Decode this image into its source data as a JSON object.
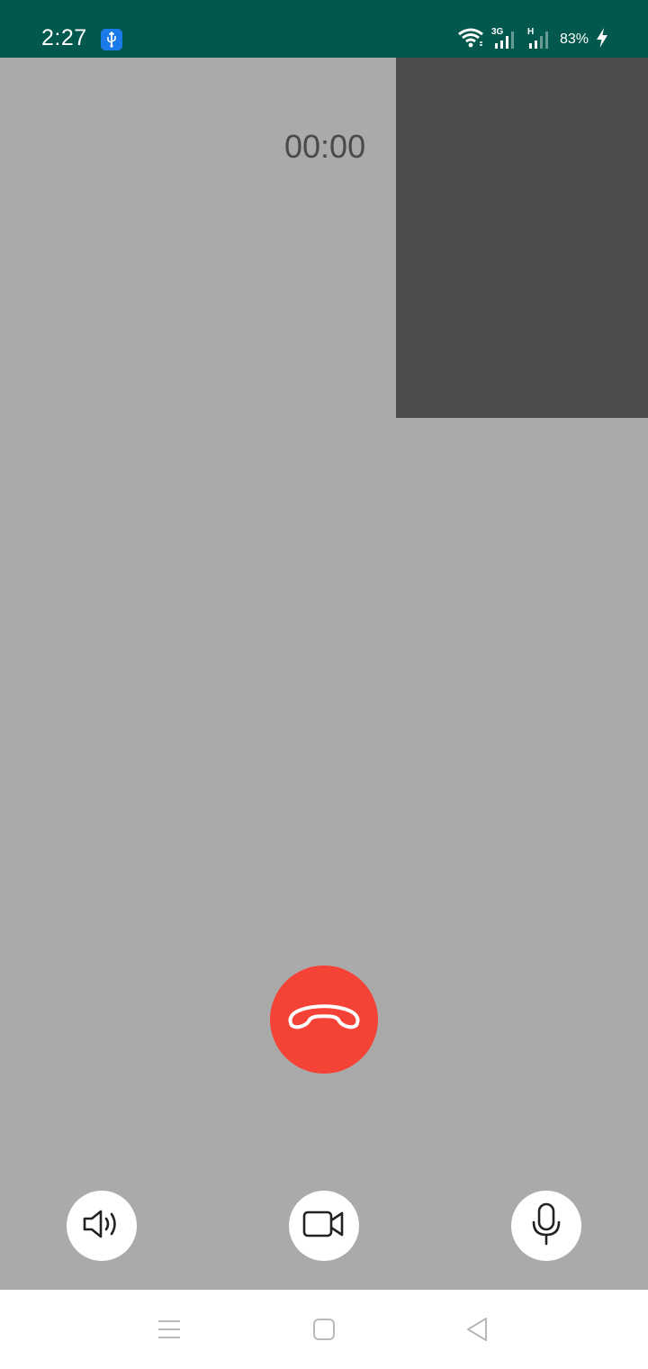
{
  "status_bar": {
    "time": "2:27",
    "network_1": "3G",
    "network_2": "H",
    "battery": "83%",
    "icons": [
      "usb-debug-icon",
      "wifi-icon",
      "signal-3g-icon",
      "signal-h-icon",
      "charging-icon"
    ]
  },
  "call": {
    "timer": "00:00",
    "end_call_icon": "phone-hangup-icon",
    "end_call_color": "#f54236"
  },
  "controls": [
    {
      "icon": "speaker-icon"
    },
    {
      "icon": "video-camera-icon"
    },
    {
      "icon": "microphone-icon"
    }
  ],
  "nav": {
    "icons": [
      "menu-icon",
      "home-icon",
      "back-icon"
    ]
  },
  "colors": {
    "status_bar": "#02584c",
    "background": "#aaaaaa",
    "preview": "#4b4c4c"
  }
}
